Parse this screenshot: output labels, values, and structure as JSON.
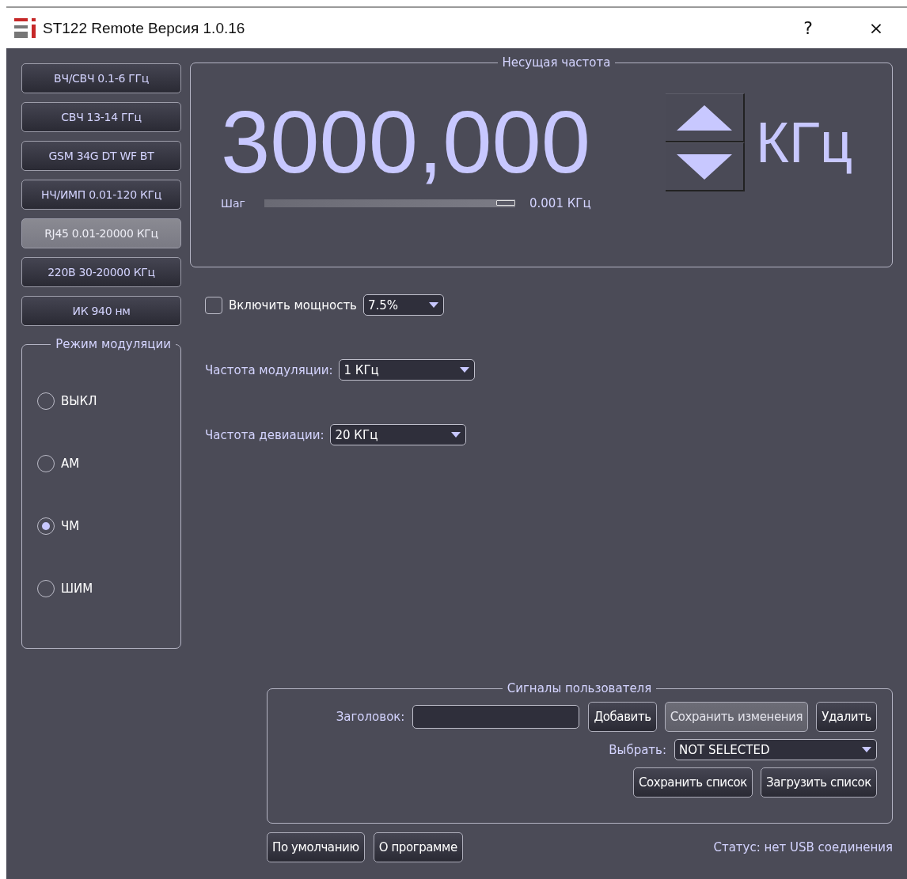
{
  "window": {
    "title": "ST122 Remote Версия 1.0.16",
    "help": "?",
    "close": "×"
  },
  "bands": [
    {
      "label": "ВЧ/СВЧ 0.1-6 ГГц",
      "selected": false
    },
    {
      "label": "СВЧ 13-14 ГГц",
      "selected": false
    },
    {
      "label": "GSM 34G DT WF BT",
      "selected": false
    },
    {
      "label": "НЧ/ИМП 0.01-120 КГц",
      "selected": false
    },
    {
      "label": "RJ45 0.01-20000 КГц",
      "selected": true
    },
    {
      "label": "220В 30-20000 КГц",
      "selected": false
    },
    {
      "label": "ИК 940 нм",
      "selected": false
    }
  ],
  "modulation_mode": {
    "title": "Режим модуляции",
    "options": [
      {
        "label": "ВЫКЛ",
        "selected": false
      },
      {
        "label": "АМ",
        "selected": false
      },
      {
        "label": "ЧМ",
        "selected": true
      },
      {
        "label": "ШИМ",
        "selected": false
      }
    ]
  },
  "carrier": {
    "title": "Несущая частота",
    "value": "3000,000",
    "unit": "КГц",
    "step_label": "Шаг",
    "step": {
      "level": 1
    },
    "step_reading": "0.001 КГц"
  },
  "power": {
    "label": "Включить мощность",
    "checked": false,
    "value": "7.5%"
  },
  "mod_freq": {
    "label": "Частота модуляции:",
    "value": "1 КГц"
  },
  "dev_freq": {
    "label": "Частота девиации:",
    "value": "20 КГц"
  },
  "user_signals": {
    "title": "Сигналы пользователя",
    "title_label": "Заголовок:",
    "buttons": [
      {
        "label": "Добавить",
        "disabled": false
      },
      {
        "label": "Сохранить изменения",
        "disabled": true
      },
      {
        "label": "Удалить",
        "disabled": false
      }
    ],
    "select_label": "Выбрать:",
    "select_value": "NOT SELECTED",
    "list_buttons": [
      {
        "label": "Сохранить список",
        "disabled": false
      },
      {
        "label": "Загрузить список",
        "disabled": false
      }
    ]
  },
  "footer": {
    "buttons": [
      {
        "label": "По умолчанию"
      },
      {
        "label": "О программе"
      }
    ],
    "status": "Статус: нет USB соединения"
  }
}
